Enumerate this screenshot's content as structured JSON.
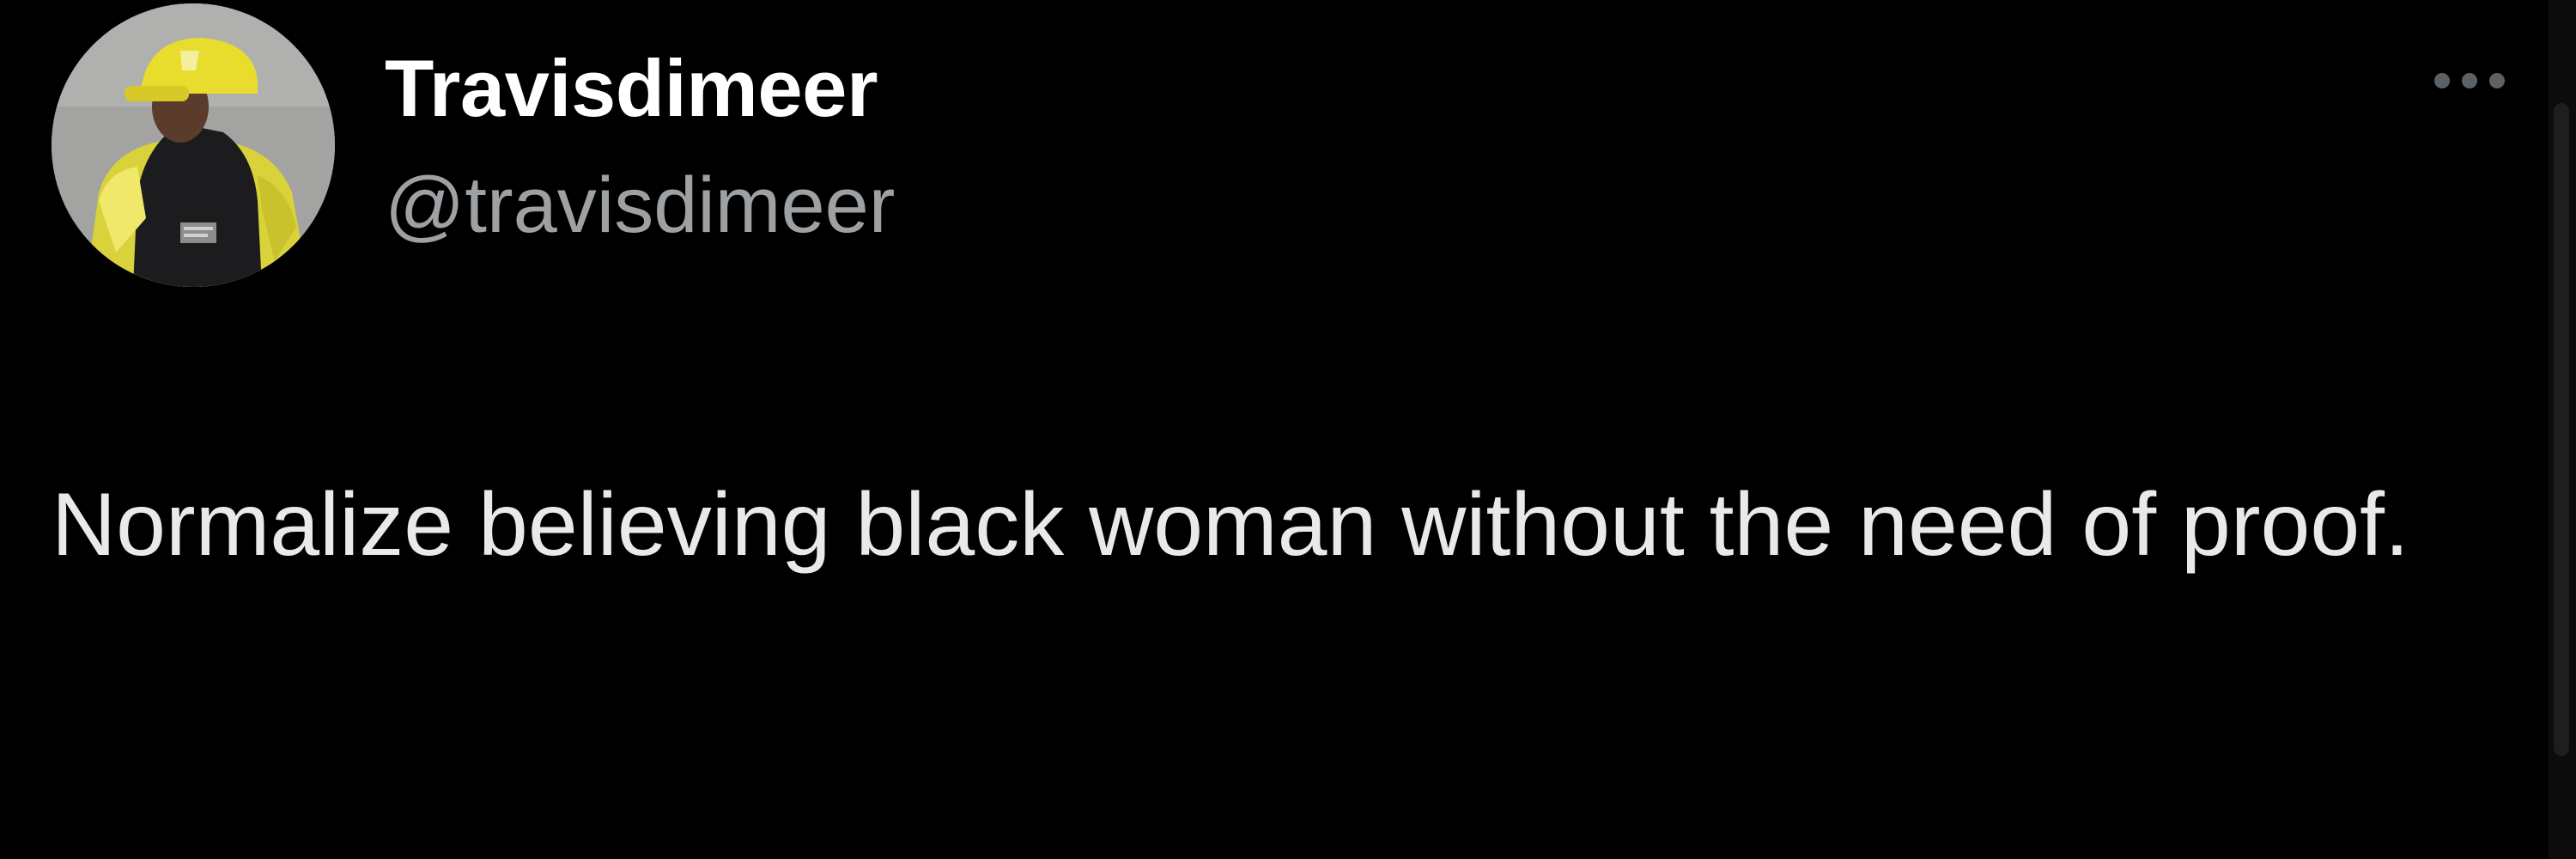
{
  "tweet": {
    "author": {
      "display_name": "Travisdimeer",
      "handle": "@travisdimeer",
      "avatar_icon": "profile-photo"
    },
    "more_icon": "more-options-icon",
    "text": "Normalize believing black woman without the need of proof."
  },
  "colors": {
    "background": "#000000",
    "name": "#ffffff",
    "handle": "#9ea1a4",
    "body_text": "#e7e9ea",
    "more_dots": "#5c6166"
  }
}
